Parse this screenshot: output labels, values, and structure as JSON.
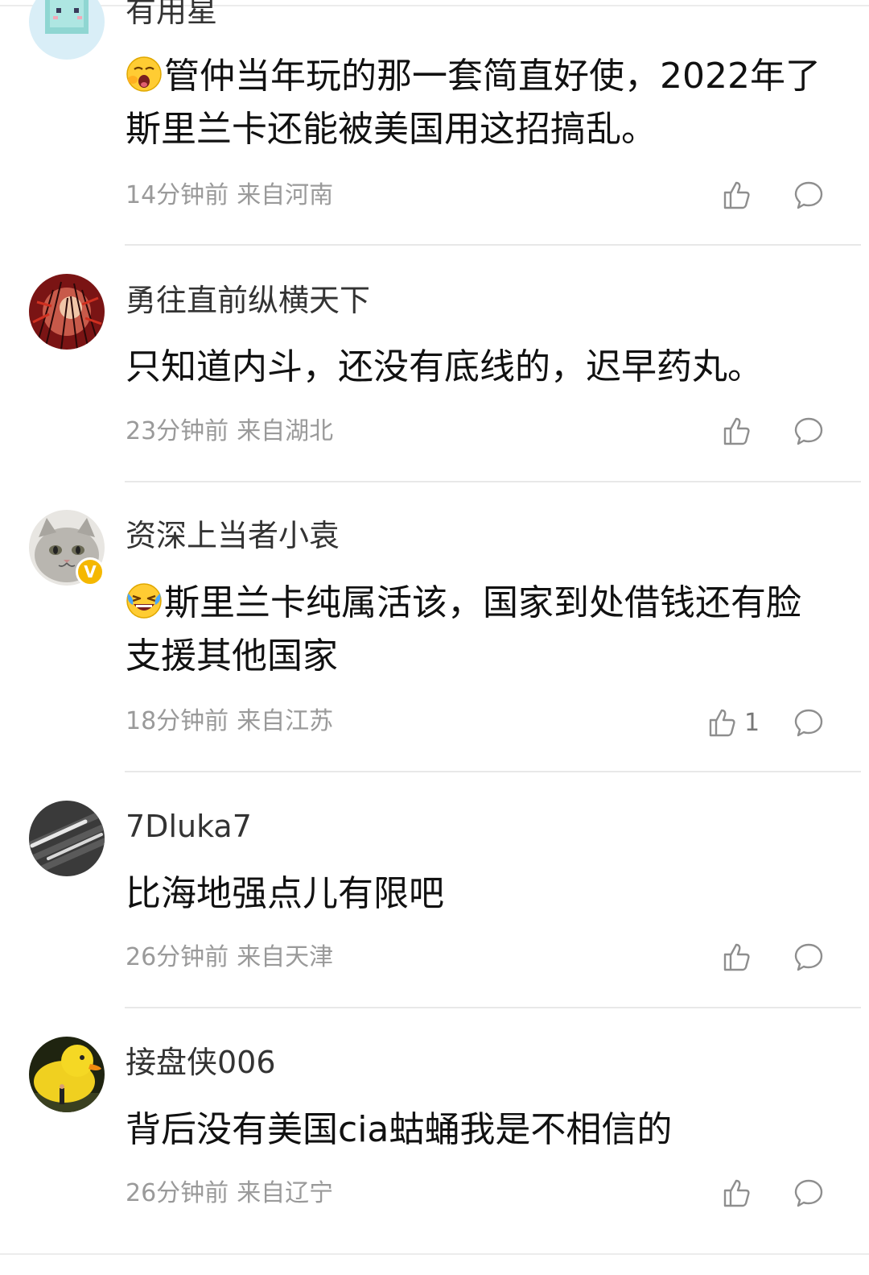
{
  "comments": [
    {
      "username": "有用星",
      "content": "管仲当年玩的那一套简直好使，2022年了斯里兰卡还能被美国用这招搞乱。",
      "time": "14分钟前",
      "location": "来自河南",
      "likes": "",
      "emoji": "yawning-face-emoji",
      "avatar": "pixel-character-avatar"
    },
    {
      "username": "勇往直前纵横天下",
      "content": "只知道内斗，还没有底线的，迟早药丸。",
      "time": "23分钟前",
      "location": "来自湖北",
      "likes": "",
      "avatar": "red-forest-avatar"
    },
    {
      "username": "资深上当者小袁",
      "content": "斯里兰卡纯属活该，国家到处借钱还有脸支援其他国家",
      "time": "18分钟前",
      "location": "来自江苏",
      "likes": "1",
      "emoji": "laughing-crying-emoji",
      "avatar": "cat-avatar",
      "badge": "V"
    },
    {
      "username": "7Dluka7",
      "content": "比海地强点儿有限吧",
      "time": "26分钟前",
      "location": "来自天津",
      "likes": "",
      "avatar": "striped-dark-avatar"
    },
    {
      "username": "接盘侠006",
      "content": "背后没有美国cia蛄蛹我是不相信的",
      "time": "26分钟前",
      "location": "来自辽宁",
      "likes": "",
      "avatar": "yellow-duck-avatar"
    }
  ],
  "colors": {
    "meta_text": "#9a9a9a",
    "icon_stroke": "#8e8e8e",
    "badge": "#f5b800",
    "divider": "#e8e8e8"
  }
}
